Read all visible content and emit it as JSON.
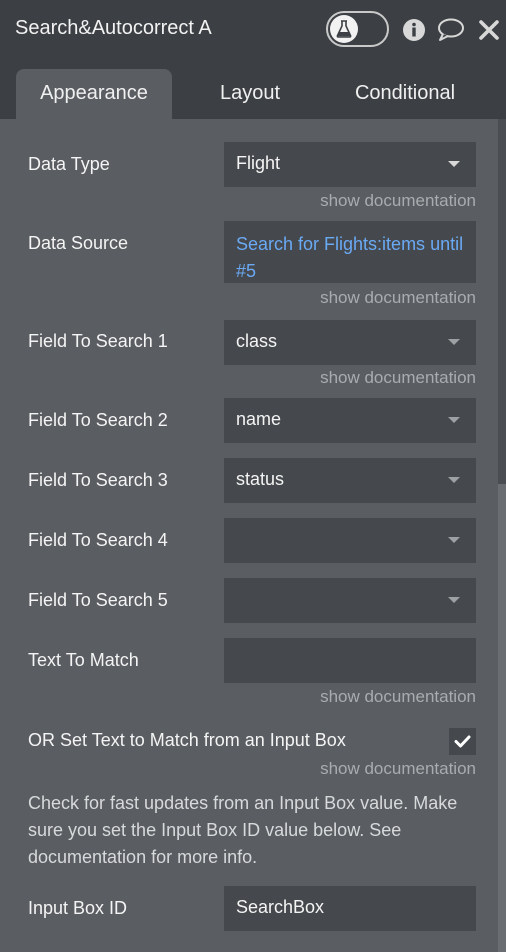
{
  "header": {
    "title": "Search&Autocorrect A",
    "icons": [
      "flask-icon",
      "info-icon",
      "comment-icon",
      "close-icon"
    ]
  },
  "tabs": [
    {
      "label": "Appearance",
      "active": true
    },
    {
      "label": "Layout",
      "active": false
    },
    {
      "label": "Conditional",
      "active": false
    }
  ],
  "doc_link_label": "show documentation",
  "fields": {
    "data_type": {
      "label": "Data Type",
      "value": "Flight"
    },
    "data_source": {
      "label": "Data Source",
      "value": "Search for Flights:items until #5"
    },
    "field_to_search_1": {
      "label": "Field To Search 1",
      "value": "class"
    },
    "field_to_search_2": {
      "label": "Field To Search 2",
      "value": "name"
    },
    "field_to_search_3": {
      "label": "Field To Search 3",
      "value": "status"
    },
    "field_to_search_4": {
      "label": "Field To Search 4",
      "value": ""
    },
    "field_to_search_5": {
      "label": "Field To Search 5",
      "value": ""
    },
    "text_to_match": {
      "label": "Text To Match",
      "value": ""
    },
    "or_set_text": {
      "label": "OR Set Text to Match from an Input Box",
      "checked": true
    },
    "help_text": "Check for fast updates from an Input Box value. Make sure you set the Input Box ID value below. See documentation for more info.",
    "input_box_id": {
      "label": "Input Box ID",
      "value": "SearchBox"
    }
  },
  "colors": {
    "panel": "#5a5e62",
    "header": "#3c4044",
    "input": "#45494d",
    "link": "#6aa9f4"
  }
}
